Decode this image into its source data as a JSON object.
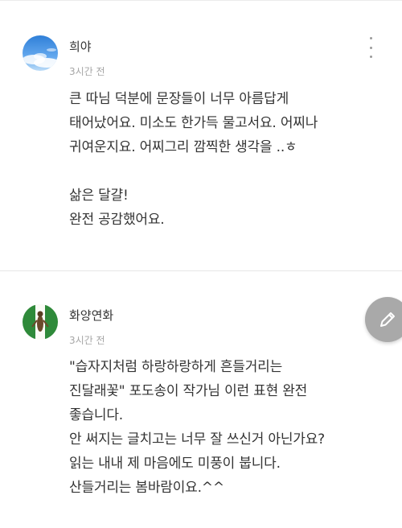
{
  "comments": [
    {
      "author": "희야",
      "time": "3시간 전",
      "avatar": "sky-cloud-avatar",
      "more_icon": "more-vertical-icon",
      "lines": [
        "큰 따님 덕분에 문장들이 너무 아름답게",
        "태어났어요. 미소도 한가득 물고서요. 어찌나",
        "귀여운지요. 어찌그리 깜찍한 생각을 ..ㅎ",
        "",
        "삶은 달걀!",
        "완전 공감했어요."
      ]
    },
    {
      "author": "화양연화",
      "time": "3시간 전",
      "avatar": "green-flag-figure-avatar",
      "more_icon": "more-vertical-icon",
      "lines": [
        "\"습자지처럼 하랑하랑하게 흔들거리는",
        "진달래꽃\" 포도송이 작가님 이런 표현 완전",
        "좋습니다.",
        "안 써지는 글치고는 너무 잘 쓰신거 아닌가요?",
        "읽는 내내 제 마음에도 미풍이 붑니다.",
        "산들거리는 봄바람이요.^^"
      ]
    }
  ],
  "fab": {
    "icon": "pencil-icon"
  },
  "colors": {
    "text": "#333333",
    "meta": "#a6a6a6",
    "divider": "#e6e6e6",
    "fab": "#a9a9a9"
  }
}
